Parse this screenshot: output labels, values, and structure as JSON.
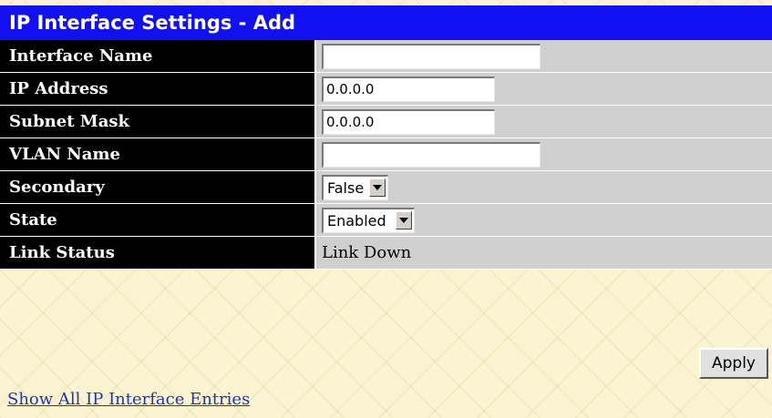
{
  "header": {
    "title": "IP Interface Settings - Add"
  },
  "form": {
    "interface_name": {
      "label": "Interface Name",
      "value": ""
    },
    "ip_address": {
      "label": "IP Address",
      "value": "0.0.0.0"
    },
    "subnet_mask": {
      "label": "Subnet Mask",
      "value": "0.0.0.0"
    },
    "vlan_name": {
      "label": "VLAN Name",
      "value": ""
    },
    "secondary": {
      "label": "Secondary",
      "value": "False"
    },
    "state": {
      "label": "State",
      "value": "Enabled"
    },
    "link_status": {
      "label": "Link Status",
      "value": "Link Down"
    }
  },
  "actions": {
    "apply_label": "Apply"
  },
  "footer": {
    "show_all_link": "Show All IP Interface Entries"
  },
  "colors": {
    "title_bar": "#1010f0",
    "label_bg": "#000000",
    "value_bg": "#cfcfcf",
    "page_bg": "#fbf4d2",
    "link": "#1a37b8"
  }
}
